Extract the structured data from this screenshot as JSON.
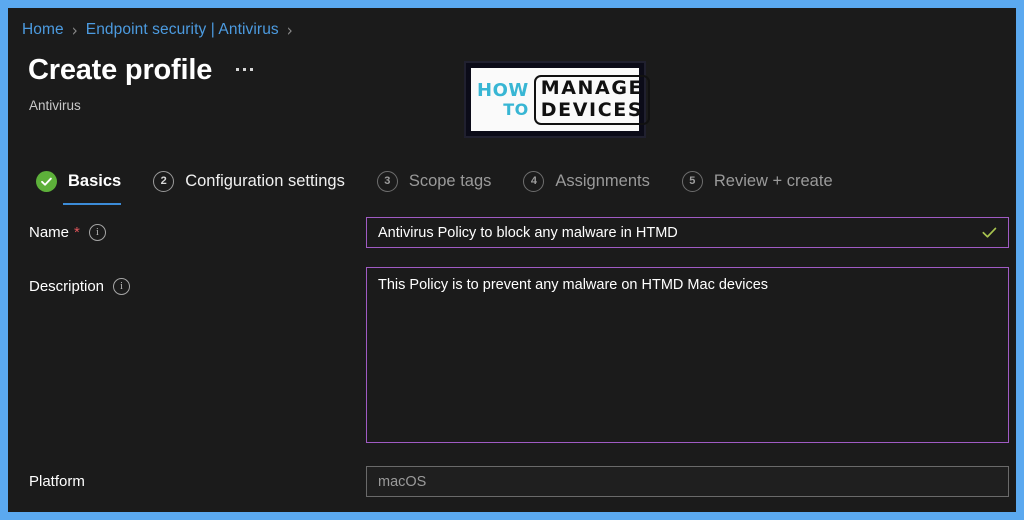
{
  "window": {
    "frame_color": "#5BA9F0",
    "background": "#1B1B1B"
  },
  "breadcrumb": {
    "items": [
      {
        "label": "Home"
      },
      {
        "label": "Endpoint security | Antivirus"
      }
    ],
    "separator": "›",
    "link_color": "#4C9BE0"
  },
  "header": {
    "title": "Create profile",
    "subtitle": "Antivirus",
    "overflow_menu_label": "···"
  },
  "logo": {
    "line1": "HOW",
    "line2": "TO",
    "word1": "MANAGE",
    "word2": "DEVICES",
    "accent_color": "#38B6D4"
  },
  "wizard": {
    "steps": [
      {
        "number": "1",
        "label": "Basics",
        "state": "completed-active",
        "marker": "check"
      },
      {
        "number": "2",
        "label": "Configuration settings",
        "state": "upcoming",
        "marker": "2"
      },
      {
        "number": "3",
        "label": "Scope tags",
        "state": "disabled",
        "marker": "3"
      },
      {
        "number": "4",
        "label": "Assignments",
        "state": "disabled",
        "marker": "4"
      },
      {
        "number": "5",
        "label": "Review + create",
        "state": "disabled",
        "marker": "5"
      }
    ],
    "active_underline_color": "#3C8CD8",
    "completed_color": "#5DB03A"
  },
  "form": {
    "name": {
      "label": "Name",
      "required": true,
      "required_marker": "*",
      "info_icon": "info-icon",
      "value": "Antivirus Policy to block any malware in HTMD",
      "placeholder": "Enter a name",
      "validation": "valid",
      "border_color": "#A05BC4",
      "check_color": "#A8C44F"
    },
    "description": {
      "label": "Description",
      "info_icon": "info-icon",
      "value": "This Policy is to prevent any malware on HTMD Mac devices",
      "placeholder": "Enter a description",
      "border_color": "#A05BC4"
    },
    "platform": {
      "label": "Platform",
      "value": "macOS",
      "readonly": true,
      "border_color": "#6A6A6A"
    }
  }
}
